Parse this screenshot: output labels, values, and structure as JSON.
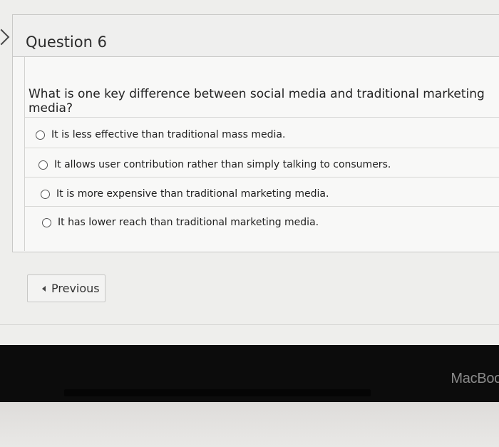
{
  "question": {
    "title": "Question 6",
    "text": "What is one key difference between social media and traditional marketing media?",
    "options": [
      {
        "label": "It is less effective than traditional mass media."
      },
      {
        "label": "It allows user contribution rather than simply talking to consumers."
      },
      {
        "label": "It is more expensive than traditional marketing media."
      },
      {
        "label": "It has lower reach than traditional marketing media."
      }
    ]
  },
  "navigation": {
    "previous_label": "Previous"
  },
  "device": {
    "brand": "MacBoo"
  },
  "colors": {
    "card_bg": "#f7f7f6",
    "border": "#c9c9c7",
    "bezel": "#0c0c0c"
  }
}
